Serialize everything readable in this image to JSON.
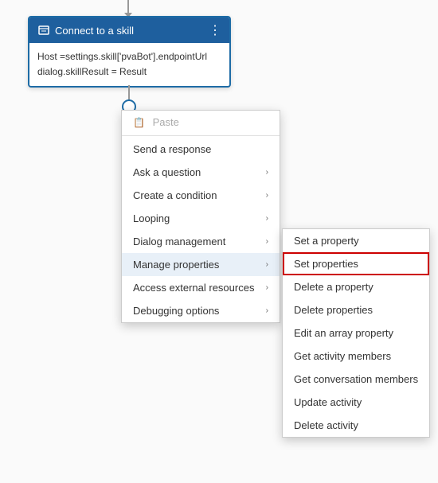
{
  "node": {
    "title": "Connect to a skill",
    "line1": "Host =settings.skill['pvaBot'].endpointUrl",
    "line2": "dialog.skillResult = Result",
    "menu_icon": "⋮"
  },
  "context_menu": {
    "items": [
      {
        "id": "paste",
        "label": "Paste",
        "icon": "📋",
        "disabled": true,
        "has_arrow": false
      },
      {
        "id": "send-response",
        "label": "Send a response",
        "disabled": false,
        "has_arrow": false
      },
      {
        "id": "ask-question",
        "label": "Ask a question",
        "disabled": false,
        "has_arrow": true
      },
      {
        "id": "create-condition",
        "label": "Create a condition",
        "disabled": false,
        "has_arrow": true
      },
      {
        "id": "looping",
        "label": "Looping",
        "disabled": false,
        "has_arrow": true
      },
      {
        "id": "dialog-management",
        "label": "Dialog management",
        "disabled": false,
        "has_arrow": true
      },
      {
        "id": "manage-properties",
        "label": "Manage properties",
        "disabled": false,
        "has_arrow": true,
        "active": true
      },
      {
        "id": "access-external",
        "label": "Access external resources",
        "disabled": false,
        "has_arrow": true
      },
      {
        "id": "debugging",
        "label": "Debugging options",
        "disabled": false,
        "has_arrow": true
      }
    ]
  },
  "submenu": {
    "items": [
      {
        "id": "set-property",
        "label": "Set a property",
        "highlighted": false
      },
      {
        "id": "set-properties",
        "label": "Set properties",
        "highlighted": true
      },
      {
        "id": "delete-property",
        "label": "Delete a property",
        "highlighted": false
      },
      {
        "id": "delete-properties",
        "label": "Delete properties",
        "highlighted": false
      },
      {
        "id": "edit-array",
        "label": "Edit an array property",
        "highlighted": false
      },
      {
        "id": "get-activity-members",
        "label": "Get activity members",
        "highlighted": false
      },
      {
        "id": "get-conversation-members",
        "label": "Get conversation members",
        "highlighted": false
      },
      {
        "id": "update-activity",
        "label": "Update activity",
        "highlighted": false
      },
      {
        "id": "delete-activity",
        "label": "Delete activity",
        "highlighted": false
      }
    ]
  }
}
